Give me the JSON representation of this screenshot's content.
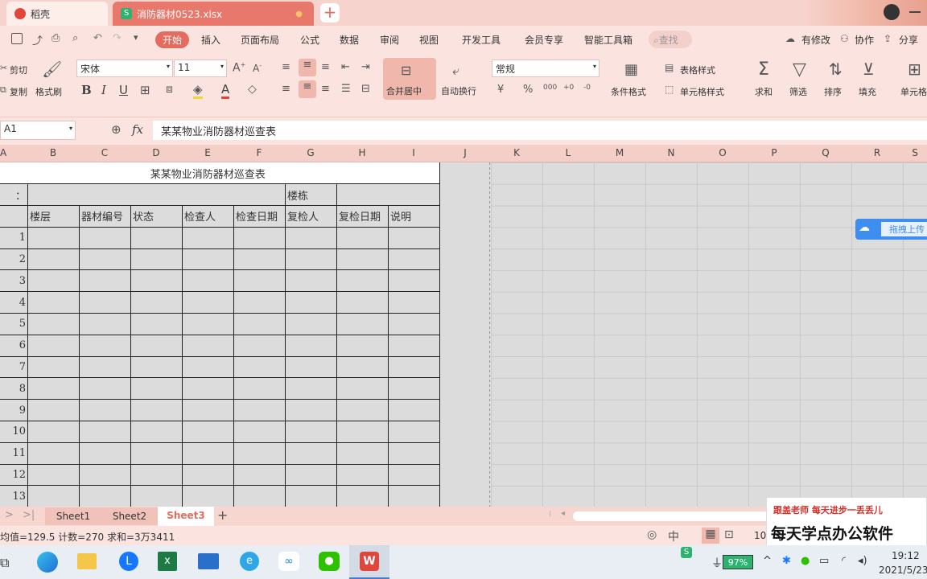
{
  "tabs": [
    {
      "label": "稻壳",
      "icon": "wps-logo-icon"
    },
    {
      "label": "消防器材0523.xlsx",
      "icon": "spreadsheet-s-icon"
    }
  ],
  "menu": {
    "items": [
      "开始",
      "插入",
      "页面布局",
      "公式",
      "数据",
      "审阅",
      "视图",
      "开发工具",
      "会员专享",
      "智能工具箱"
    ],
    "active": "开始",
    "search": "查找",
    "right": [
      "有修改",
      "协作",
      "分享"
    ]
  },
  "ribbon": {
    "cut": "剪切",
    "copy": "复制",
    "format_painter": "格式刷",
    "font": "宋体",
    "font_size": "11",
    "merge": "合并居中",
    "wrap": "自动换行",
    "number_format": "常规",
    "table_style": "表格样式",
    "conditional_format": "条件格式",
    "cell_style": "单元格样式",
    "sum": "求和",
    "filter": "筛选",
    "sort": "排序",
    "fill": "填充",
    "cell": "单元格",
    "currency": "¥",
    "percent": "%",
    "thousands": "000"
  },
  "formula": {
    "cell_ref": "A1",
    "fx": "fx",
    "content": "某某物业消防器材巡查表"
  },
  "columns": [
    "A",
    "B",
    "C",
    "D",
    "E",
    "F",
    "G",
    "H",
    "I",
    "J",
    "K",
    "L",
    "M",
    "N",
    "O",
    "P",
    "Q",
    "R",
    "S"
  ],
  "sheet": {
    "title": "某某物业消防器材巡查表",
    "row2_label": "：",
    "building_label": "楼栋",
    "headers": [
      "楼层",
      "器材编号",
      "状态",
      "检查人",
      "检查日期",
      "复检人",
      "复检日期",
      "说明"
    ],
    "row_numbers": [
      "1",
      "2",
      "3",
      "4",
      "5",
      "6",
      "7",
      "8",
      "9",
      "10",
      "11",
      "12",
      "13"
    ]
  },
  "upload_widget": "拖拽上传",
  "sheet_tabs": [
    "Sheet1",
    "Sheet2",
    "Sheet3"
  ],
  "active_sheet": "Sheet3",
  "status": {
    "stats": "均值=129.5  计数=270  求和=3万3411",
    "zoom": "10"
  },
  "watermark": {
    "line1": "跟盖老师   每天进步一丢丢儿",
    "line2": "每天学点办公软件"
  },
  "taskbar": {
    "battery": "97%",
    "time": "19:12",
    "date": "2021/5/23"
  },
  "colors": {
    "accent": "#e56b5e",
    "ribbon_bg": "#fbe4e0",
    "grid_bg": "#dcdcdc"
  }
}
